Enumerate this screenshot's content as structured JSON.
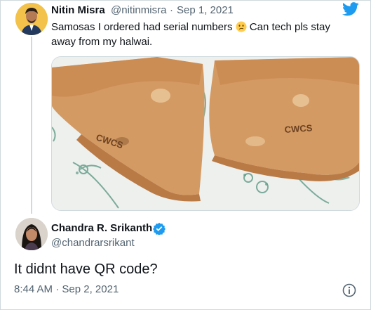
{
  "tweet": {
    "author_name": "Nitin Misra",
    "author_handle": "@nitinmisra",
    "separator": "·",
    "date": "Sep 1, 2021",
    "text": "Samosas I ordered had serial numbers",
    "text_end": " Can tech pls stay away from my halwai.",
    "emoji": "confused-face-emoji",
    "media": "samosa-photo"
  },
  "reply": {
    "author_name": "Chandra R. Srikanth",
    "author_handle": "@chandrarsrikant",
    "verified": true,
    "text": "It didnt have QR code?",
    "time": "8:44 AM",
    "separator": "·",
    "date": "Sep 2, 2021"
  },
  "icons": {
    "brand": "twitter-bird-icon",
    "info": "info-icon",
    "verified": "verified-badge-icon"
  },
  "colors": {
    "twitter_blue": "#1d9bf0",
    "text_primary": "#0f1419",
    "text_secondary": "#536471",
    "border": "#cfd9de"
  }
}
